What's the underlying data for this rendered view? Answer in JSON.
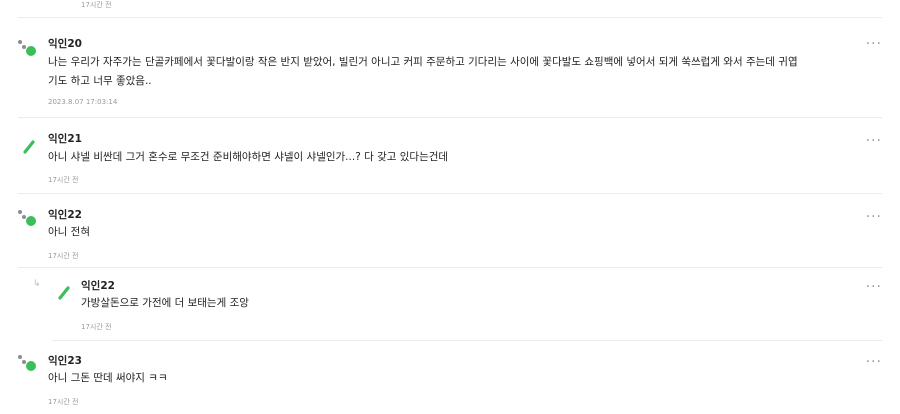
{
  "top": {
    "time": "17시간 전"
  },
  "comments": [
    {
      "author": "익인20",
      "lines": [
        "나는 우리가 자주가는 단골카페에서 꽃다발이랑 작은 반지 받았어, 빌린거 아니고 커피 주문하고 기다리는 사이에 꽃다발도 쇼핑백에 넣어서 되게 쑥쓰럽게 와서 주는데 귀엽",
        "기도 하고 너무 좋았음.."
      ],
      "time": "2023.8.07 17:03:14",
      "more_icon": "more-dots-icon",
      "avatar_icon": "dots-avatar-icon"
    },
    {
      "author": "익인21",
      "lines": [
        "아니 샤넬 비싼데 그거 혼수로 무조건 준비해야하면 샤넬이 샤넬인가...? 다 갖고 있다는건데"
      ],
      "time": "17시간 전",
      "avatar_icon": "leaf-avatar-icon"
    },
    {
      "author": "익인22",
      "lines": [
        "아니 전혀"
      ],
      "time": "17시간 전",
      "avatar_icon": "dots-avatar-icon"
    },
    {
      "author": "익인22",
      "lines": [
        "가방살돈으로 가전에 더 보태는게 조앙"
      ],
      "time": "17시간 전",
      "is_reply": true,
      "avatar_icon": "leaf-avatar-icon"
    },
    {
      "author": "익인23",
      "lines": [
        "아니 그돈 딴데 써야지 ㅋㅋ"
      ],
      "time": "17시간 전",
      "avatar_icon": "dots-avatar-icon"
    }
  ],
  "more_label": "···",
  "reply_arrow": "↳",
  "colors": {
    "green": "#3cbf5a",
    "gray_dot": "#8d8d8d"
  }
}
